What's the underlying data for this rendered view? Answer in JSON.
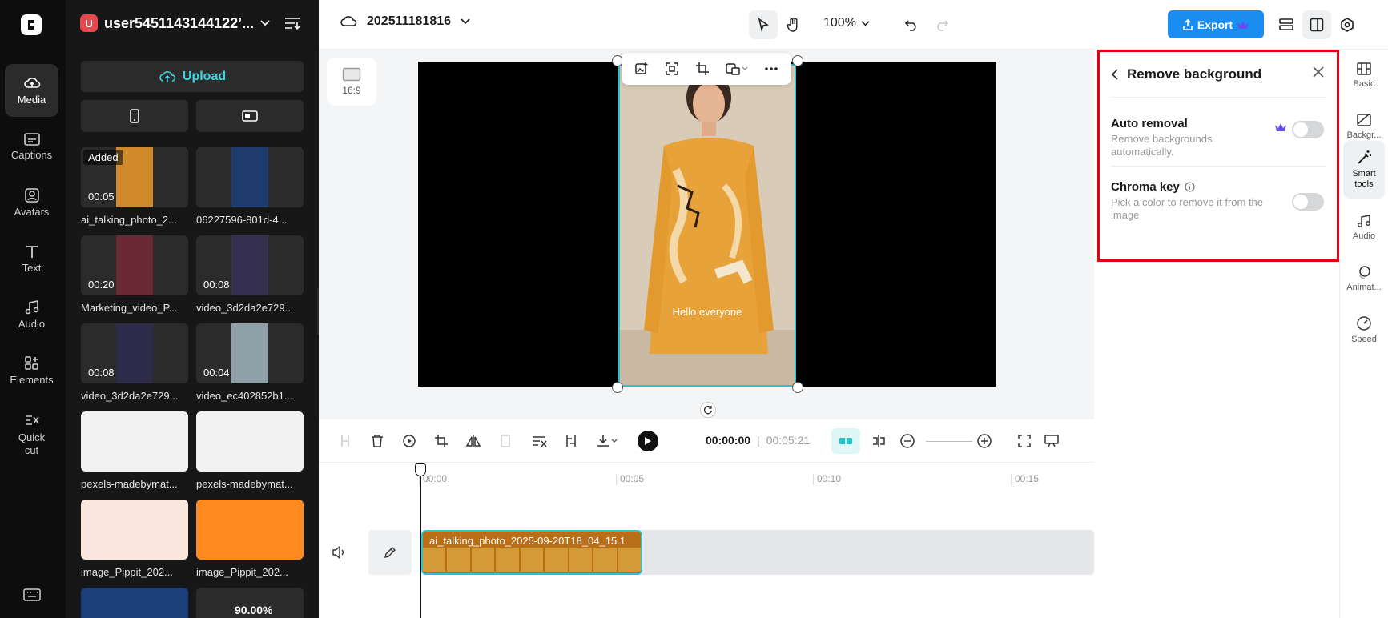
{
  "left_nav": {
    "items": [
      {
        "label": "Media",
        "icon": "cloud-media-icon",
        "active": true
      },
      {
        "label": "Captions",
        "icon": "captions-icon"
      },
      {
        "label": "Avatars",
        "icon": "avatar-icon"
      },
      {
        "label": "Text",
        "icon": "text-icon"
      },
      {
        "label": "Audio",
        "icon": "music-note-icon"
      },
      {
        "label": "Elements",
        "icon": "elements-icon"
      },
      {
        "label": "Quick cut",
        "icon": "quick-cut-icon"
      }
    ]
  },
  "media_panel": {
    "avatar_letter": "U",
    "username": "user5451143144122’...",
    "upload_label": "Upload",
    "items": [
      {
        "label": "ai_talking_photo_2...",
        "duration": "00:05",
        "badge": "Added",
        "color": "#d08a2a"
      },
      {
        "label": "06227596-801d-4...",
        "duration": "",
        "badge": "",
        "color": "#1f3b6b"
      },
      {
        "label": "Marketing_video_P...",
        "duration": "00:20",
        "badge": "",
        "color": "#6a2a33"
      },
      {
        "label": "video_3d2da2e729...",
        "duration": "00:08",
        "badge": "",
        "color": "#35304f"
      },
      {
        "label": "video_3d2da2e729...",
        "duration": "00:08",
        "badge": "",
        "color": "#2e2b4a"
      },
      {
        "label": "video_ec402852b1...",
        "duration": "00:04",
        "badge": "",
        "color": "#8fa1a8"
      },
      {
        "label": "pexels-madebymat...",
        "duration": "",
        "badge": "",
        "color": "#f1f1f1"
      },
      {
        "label": "pexels-madebymat...",
        "duration": "",
        "badge": "",
        "color": "#f1f1f1"
      },
      {
        "label": "image_Pippit_202...",
        "duration": "",
        "badge": "",
        "color": "#fbe7df"
      },
      {
        "label": "image_Pippit_202...",
        "duration": "",
        "badge": "",
        "color": "#ff8a1f"
      },
      {
        "label": "",
        "duration": "",
        "badge": "",
        "color": "#1c3f7a"
      },
      {
        "label": "",
        "duration": "",
        "badge": "90.00%",
        "color": "#2b2b2b"
      }
    ]
  },
  "topbar": {
    "project_name": "202511181816",
    "zoom": "100%",
    "export_label": "Export"
  },
  "stage": {
    "ratio_label": "16:9",
    "caption_text": "Hello everyone"
  },
  "playback": {
    "current_time": "00:00:00",
    "separator": "|",
    "total_time": "00:05:21"
  },
  "timeline": {
    "ruler": [
      "00:00",
      "00:05",
      "00:10",
      "00:15"
    ],
    "clip_name": "ai_talking_photo_2025-09-20T18_04_15.1"
  },
  "right_panel": {
    "title": "Remove background",
    "auto_removal": {
      "title": "Auto removal",
      "desc": "Remove backgrounds automatically.",
      "enabled": false
    },
    "chroma_key": {
      "title": "Chroma key",
      "desc": "Pick a color to remove it from the image",
      "enabled": false
    }
  },
  "right_nav": {
    "items": [
      {
        "label": "Basic",
        "icon": "basic-icon"
      },
      {
        "label": "Backgr...",
        "icon": "background-icon"
      },
      {
        "label": "Smart tools",
        "icon": "magic-wand-icon",
        "active": true
      },
      {
        "label": "Audio",
        "icon": "music-note-icon"
      },
      {
        "label": "Animat...",
        "icon": "animation-icon"
      },
      {
        "label": "Speed",
        "icon": "speed-icon"
      }
    ]
  },
  "colors": {
    "accent": "#2cc3cc",
    "export": "#1b8cf0",
    "highlight": "#e60012",
    "crown": "#6b4cf0"
  }
}
